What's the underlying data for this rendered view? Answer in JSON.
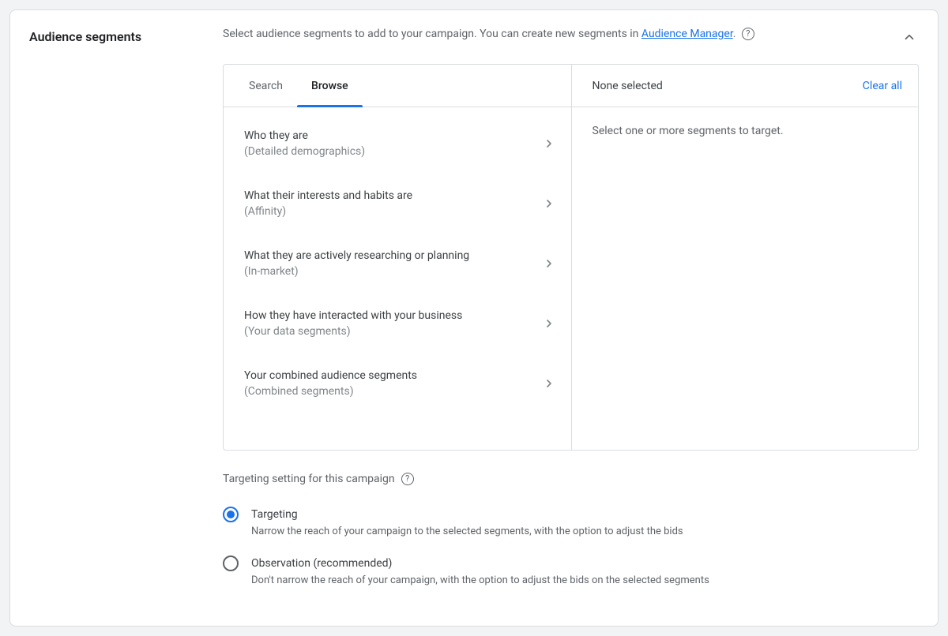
{
  "header": {
    "title": "Audience segments",
    "description_prefix": "Select audience segments to add to your campaign. You can create new segments in ",
    "description_link_text": "Audience Manager",
    "description_suffix": "."
  },
  "tabs": {
    "search": "Search",
    "browse": "Browse",
    "active": "browse"
  },
  "categories": [
    {
      "title": "Who they are",
      "sub": "(Detailed demographics)"
    },
    {
      "title": "What their interests and habits are",
      "sub": "(Affinity)"
    },
    {
      "title": "What they are actively researching or planning",
      "sub": "(In-market)"
    },
    {
      "title": "How they have interacted with your business",
      "sub": "(Your data segments)"
    },
    {
      "title": "Your combined audience segments",
      "sub": "(Combined segments)"
    }
  ],
  "selected": {
    "header": "None selected",
    "clear": "Clear all",
    "placeholder": "Select one or more segments to target."
  },
  "targeting": {
    "label": "Targeting setting for this campaign",
    "options": [
      {
        "title": "Targeting",
        "sub": "Narrow the reach of your campaign to the selected segments, with the option to adjust the bids",
        "checked": true
      },
      {
        "title": "Observation (recommended)",
        "sub": "Don't narrow the reach of your campaign, with the option to adjust the bids on the selected segments",
        "checked": false
      }
    ]
  }
}
